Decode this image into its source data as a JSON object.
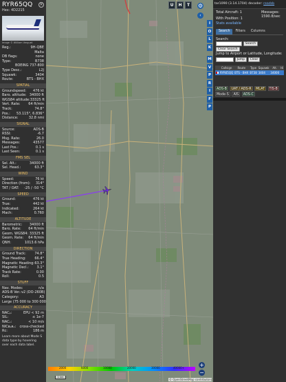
{
  "aircraft": {
    "callsign": "RYR65QQ",
    "hex": "Hex:  4D2215",
    "photo_credit": "Image © William Verguet",
    "details": [
      {
        "k": "Reg.:",
        "v": "9H-QBE",
        "link": true
      },
      {
        "k": "",
        "v": "Malta",
        "link": false
      },
      {
        "k": "DB flags:",
        "v": "none",
        "link": false
      },
      {
        "k": "Type:",
        "v": "B738",
        "link": false
      },
      {
        "k": "",
        "v": "BOEING 737-800",
        "link": false
      },
      {
        "k": "Type Desc.:",
        "v": "L2J",
        "link": false
      },
      {
        "k": "Squawk:",
        "v": "3404",
        "link": false
      },
      {
        "k": "Route:",
        "v": "BTS - BHX",
        "link": false
      }
    ],
    "spatial_title": "SPATIAL",
    "spatial": [
      {
        "k": "Groundspeed:",
        "v": "476 kt"
      },
      {
        "k": "Baro. altitude:",
        "v": "34000 ft"
      },
      {
        "k": "WGS84 altitude:",
        "v": "33325 ft"
      },
      {
        "k": "Vert. Rate:",
        "v": "64 ft/min"
      },
      {
        "k": "Track:",
        "v": "74.8°"
      },
      {
        "k": "Pos.:",
        "v": "53.115°, 6.836°"
      },
      {
        "k": "Distance:",
        "v": "32.8 nmi"
      }
    ],
    "signal_title": "SIGNAL",
    "signal": [
      {
        "k": "Source:",
        "v": "ADS-B"
      },
      {
        "k": "RSSI:",
        "v": "-6.7"
      },
      {
        "k": "Msg. Rate:",
        "v": "26.0"
      },
      {
        "k": "Messages:",
        "v": "43577"
      },
      {
        "k": "Last Pos.:",
        "v": "0.1 s"
      },
      {
        "k": "Last Seen:",
        "v": "0.1 s"
      }
    ],
    "fms_title": "FMS SEL",
    "fms": [
      {
        "k": "Sel. Alt.:",
        "v": "34000 ft"
      },
      {
        "k": "Sel. Head.:",
        "v": "63.3°"
      }
    ],
    "wind_title": "WIND",
    "wind": [
      {
        "k": "Speed:",
        "v": "76 kt"
      },
      {
        "k": "Direction (from):",
        "v": "314°"
      },
      {
        "k": "TAT / OAT:",
        "v": "-25 / -50 °C"
      }
    ],
    "speed_title": "SPEED",
    "speed": [
      {
        "k": "Ground:",
        "v": "476 kt"
      },
      {
        "k": "True:",
        "v": "442 kt"
      },
      {
        "k": "Indicated:",
        "v": "264 kt"
      },
      {
        "k": "Mach:",
        "v": "0.760"
      }
    ],
    "altitude_title": "ALTITUDE",
    "altitude": [
      {
        "k": "Barometric:",
        "v": "34000 ft"
      },
      {
        "k": "Baro. Rate:",
        "v": "64 ft/min"
      },
      {
        "k": "Geom. WGS84:",
        "v": "33325 ft"
      },
      {
        "k": "Geom. Rate:",
        "v": "64 ft/min"
      },
      {
        "k": "QNH:",
        "v": "1013.6 hPa"
      }
    ],
    "direction_title": "DIRECTION",
    "direction": [
      {
        "k": "Ground Track:",
        "v": "74.8°"
      },
      {
        "k": "True Heading:",
        "v": "66.4°"
      },
      {
        "k": "Magnetic Heading:",
        "v": "63.3°"
      },
      {
        "k": "Magnetic Decl.:",
        "v": "3.1°"
      },
      {
        "k": "Track Rate:",
        "v": "0.00"
      },
      {
        "k": "Roll:",
        "v": "0.5"
      }
    ],
    "stuff_title": "STUFF",
    "stuff": [
      {
        "k": "Nav. Modes:",
        "v": "n/a"
      },
      {
        "k": "ADS-B Ver.:",
        "v": "v2 (DO-260B)"
      },
      {
        "k": "Category:",
        "v": "A3"
      },
      {
        "k": "Large (75 000 to 300 000 lb)",
        "v": ""
      }
    ],
    "accuracy_title": "ACCURACY",
    "accuracy": [
      {
        "k": "NACₚ:",
        "v": "EPU < 92 m"
      },
      {
        "k": "SIL:",
        "v": "≤ 1e-7"
      },
      {
        "k": "NACᵥ:",
        "v": "< 10 m/s"
      },
      {
        "k": "NICʙₐʀₒ:",
        "v": "cross-checked"
      },
      {
        "k": "Rc:",
        "v": "186 m"
      }
    ],
    "learn_more": "Learn more about Mode S data type by hovering over each data label."
  },
  "map": {
    "toolbar": [
      "U",
      "H",
      "T"
    ],
    "side_buttons": [
      "I",
      "O",
      "L",
      "K",
      "M",
      "V",
      "P",
      "R",
      "I",
      "F",
      "P"
    ],
    "legend_labels": [
      "2000",
      "6000",
      "10000",
      "20000",
      "30000",
      "40000+"
    ],
    "scale_label": "1 km",
    "attribution": "© OpenStreetMap contributors"
  },
  "right": {
    "version": "tar1090 (3.14.1704)",
    "decoder_label": "decoder:",
    "decoder_link": "readsb",
    "total_aircraft": "Total Aircraft: 1",
    "with_position": "With Position: 1",
    "stats_available": "Stats available",
    "messages_label": "Messages:",
    "messages_rate": "1590.8/sec",
    "tabs": [
      "Search",
      "Filters",
      "Columns"
    ],
    "search_label": "Search:",
    "search_btn": "Search",
    "clear_search_btn": "Clear Search",
    "jump_label": "Jump to Airport or Latitude, Longitude:",
    "jump_btn": "Jump",
    "clear_btn": "Clear",
    "columns": [
      "",
      "Callsign",
      "Route",
      "Type",
      "Squawk",
      "Alt.",
      "Hi"
    ],
    "rows": [
      [
        "",
        "RYR65QQ",
        "BTS - BHX",
        "B738",
        "3404",
        "34000",
        ""
      ]
    ],
    "chips": [
      {
        "label": "ADS-B",
        "color": "#2e4a2e"
      },
      {
        "label": "UAT / ADS-R",
        "color": "#5a4a20"
      },
      {
        "label": "MLAT",
        "color": "#5a4a10"
      },
      {
        "label": "TIS-B",
        "color": "#5a2a2a"
      },
      {
        "label": "Mode-S",
        "color": "#333333"
      },
      {
        "label": "AIS",
        "color": "#333333"
      },
      {
        "label": "ADS-C",
        "color": "#2e4a3a"
      }
    ]
  }
}
